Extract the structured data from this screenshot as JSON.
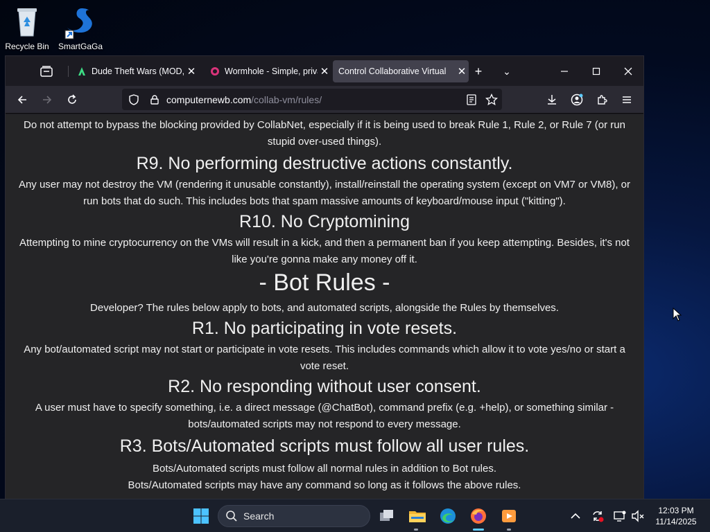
{
  "desktop": {
    "icons": [
      {
        "label": "Recycle Bin"
      },
      {
        "label": "SmartGaGa"
      }
    ]
  },
  "browser": {
    "tabs": [
      {
        "title": "Dude Theft Wars (MOD, U",
        "active": false
      },
      {
        "title": "Wormhole - Simple, priva",
        "active": false
      },
      {
        "title": "Control Collaborative Virtual",
        "active": true
      }
    ],
    "url": {
      "domain": "computernewb.com",
      "path": "/collab-vm/rules/"
    }
  },
  "page": {
    "p_r8_desc": "Do not attempt to bypass the blocking provided by CollabNet, especially if it is being used to break Rule 1, Rule 2, or Rule 7 (or run stupid over-used things).",
    "h_r9": "R9. No performing destructive actions constantly.",
    "p_r9_desc": "Any user may not destroy the VM (rendering it unusable constantly), install/reinstall the operating system (except on VM7 or VM8), or run bots that do such. This includes bots that spam massive amounts of keyboard/mouse input (\"kitting\").",
    "h_r10": "R10. No Cryptomining",
    "p_r10_desc": "Attempting to mine cryptocurrency on the VMs will result in a kick, and then a permanent ban if you keep attempting. Besides, it's not like you're gonna make any money off it.",
    "h_bot_rules": "- Bot Rules -",
    "p_bot_intro": "Developer? The rules below apply to bots, and automated scripts, alongside the Rules by themselves.",
    "h_b1": "R1. No participating in vote resets.",
    "p_b1_desc": "Any bot/automated script may not start or participate in vote resets. This includes commands which allow it to vote yes/no or start a vote reset.",
    "h_b2": "R2. No responding without user consent.",
    "p_b2_desc": "A user must have to specify something, i.e. a direct message (@ChatBot), command prefix (e.g. +help), or something similar - bots/automated scripts may not respond to every message.",
    "h_b3": "R3. Bots/Automated scripts must follow all user rules.",
    "p_b3_line1": "Bots/Automated scripts must follow all normal rules in addition to Bot rules.",
    "p_b3_line2": "Bots/Automated scripts may have any command so long as it follows the above rules."
  },
  "taskbar": {
    "search_label": "Search",
    "time": "12:03 PM",
    "date": "11/14/2025"
  },
  "colors": {
    "accent": "#60cdff",
    "page_bg": "#252527",
    "chrome_bg": "#1c1b22"
  }
}
